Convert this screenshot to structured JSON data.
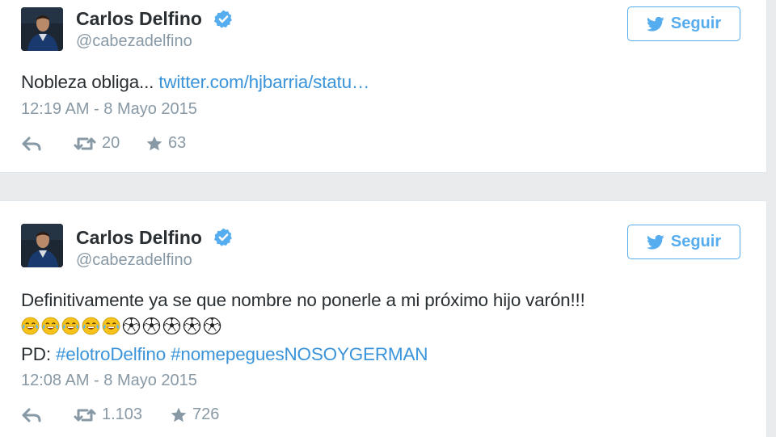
{
  "tweets": [
    {
      "author_name": "Carlos Delfino",
      "handle": "@cabezadelfino",
      "follow_label": "Seguir",
      "text_prefix": "Nobleza obliga... ",
      "link_text": "twitter.com/hjbarria/statu…",
      "timestamp": "12:19 AM - 8 Mayo 2015",
      "retweets": "20",
      "favorites": "63"
    },
    {
      "author_name": "Carlos Delfino",
      "handle": "@cabezadelfino",
      "follow_label": "Seguir",
      "text_line1": "Definitivamente ya se que nombre no ponerle a mi próximo hijo varón!!!",
      "emojis": [
        "face-with-tears-of-joy",
        "face-with-tears-of-joy",
        "face-with-tears-of-joy",
        "face-with-tears-of-joy",
        "face-with-tears-of-joy",
        "soccer-ball",
        "soccer-ball",
        "soccer-ball",
        "soccer-ball",
        "soccer-ball"
      ],
      "pd_prefix": "PD: ",
      "hashtag1": "#elotroDelfino",
      "hashtag2": "#nomepeguesNOSOYGERMAN",
      "timestamp": "12:08 AM - 8 Mayo 2015",
      "retweets": "1.103",
      "favorites": "726"
    }
  ],
  "colors": {
    "link": "#3b94d9",
    "follow_border": "#55acee",
    "muted": "#8899a6",
    "text": "#292f33",
    "verified_badge": "#55acee"
  }
}
